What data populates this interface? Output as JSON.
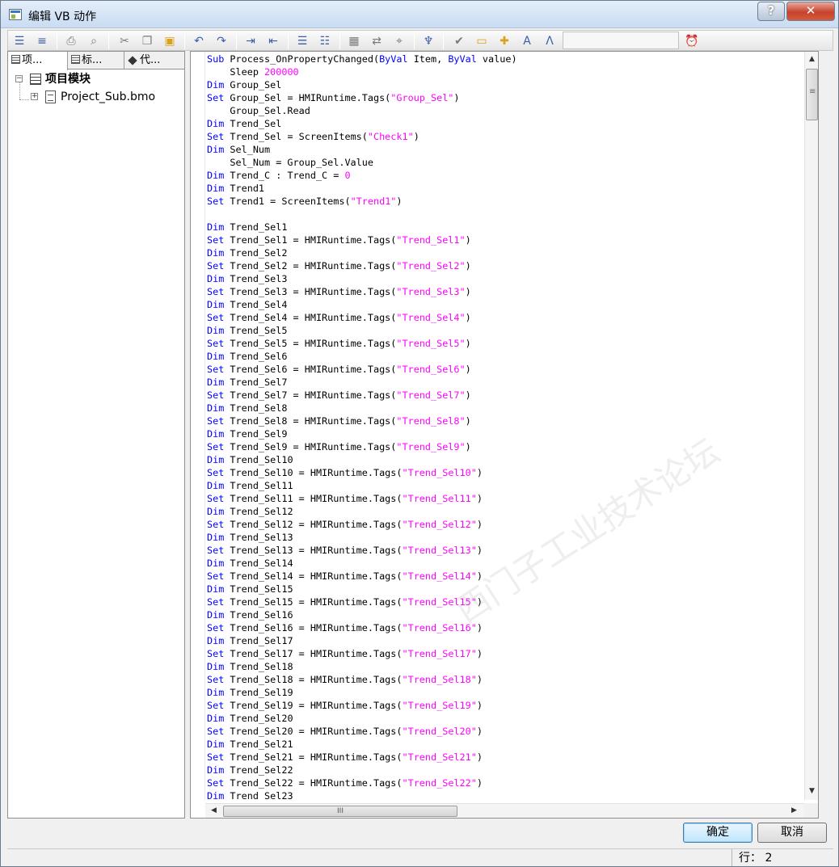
{
  "window": {
    "title": "编辑 VB 动作",
    "help_label": "?",
    "close_label": "✕"
  },
  "toolbar": {
    "icons": [
      "align-left-icon",
      "indent-icon",
      "print-icon",
      "print-preview-icon",
      "cut-icon",
      "copy-icon",
      "paste-icon",
      "undo-icon",
      "redo-icon",
      "indent-increase-icon",
      "indent-decrease-icon",
      "comment-icon",
      "uncomment-icon",
      "grid-icon",
      "replace-icon",
      "bookmark-icon",
      "properties-icon",
      "check-script-icon",
      "folder-icon",
      "insert-icon",
      "tags-icon",
      "function-icon",
      "timer-icon"
    ]
  },
  "left_panel": {
    "tabs": [
      {
        "label": "项..."
      },
      {
        "label": "标..."
      },
      {
        "label": "代..."
      }
    ],
    "tree": {
      "root_label": "项目模块",
      "child_label": "Project_Sub.bmo"
    }
  },
  "editor": {
    "lines": [
      [
        {
          "t": "Sub",
          "c": "kw"
        },
        {
          "t": " Process_OnPropertyChanged("
        },
        {
          "t": "ByVal",
          "c": "kw"
        },
        {
          "t": " Item, "
        },
        {
          "t": "ByVal",
          "c": "kw"
        },
        {
          "t": " value)"
        }
      ],
      [
        {
          "t": "    Sleep "
        },
        {
          "t": "200000",
          "c": "num"
        }
      ],
      [
        {
          "t": "Dim",
          "c": "kw"
        },
        {
          "t": " Group_Sel"
        }
      ],
      [
        {
          "t": "Set",
          "c": "kw"
        },
        {
          "t": " Group_Sel = HMIRuntime.Tags("
        },
        {
          "t": "\"Group_Sel\"",
          "c": "str"
        },
        {
          "t": ")"
        }
      ],
      [
        {
          "t": "    Group_Sel.Read"
        }
      ],
      [
        {
          "t": "Dim",
          "c": "kw"
        },
        {
          "t": " Trend_Sel"
        }
      ],
      [
        {
          "t": "Set",
          "c": "kw"
        },
        {
          "t": " Trend_Sel = ScreenItems("
        },
        {
          "t": "\"Check1\"",
          "c": "str"
        },
        {
          "t": ")"
        }
      ],
      [
        {
          "t": "Dim",
          "c": "kw"
        },
        {
          "t": " Sel_Num"
        }
      ],
      [
        {
          "t": "    Sel_Num = Group_Sel.Value"
        }
      ],
      [
        {
          "t": "Dim",
          "c": "kw"
        },
        {
          "t": " Trend_C : Trend_C = "
        },
        {
          "t": "0",
          "c": "num"
        }
      ],
      [
        {
          "t": "Dim",
          "c": "kw"
        },
        {
          "t": " Trend1"
        }
      ],
      [
        {
          "t": "Set",
          "c": "kw"
        },
        {
          "t": " Trend1 = ScreenItems("
        },
        {
          "t": "\"Trend1\"",
          "c": "str"
        },
        {
          "t": ")"
        }
      ],
      [],
      [
        {
          "t": "Dim",
          "c": "kw"
        },
        {
          "t": " Trend_Sel1"
        }
      ],
      [
        {
          "t": "Set",
          "c": "kw"
        },
        {
          "t": " Trend_Sel1 = HMIRuntime.Tags("
        },
        {
          "t": "\"Trend_Sel1\"",
          "c": "str"
        },
        {
          "t": ")"
        }
      ],
      [
        {
          "t": "Dim",
          "c": "kw"
        },
        {
          "t": " Trend_Sel2"
        }
      ],
      [
        {
          "t": "Set",
          "c": "kw"
        },
        {
          "t": " Trend_Sel2 = HMIRuntime.Tags("
        },
        {
          "t": "\"Trend_Sel2\"",
          "c": "str"
        },
        {
          "t": ")"
        }
      ],
      [
        {
          "t": "Dim",
          "c": "kw"
        },
        {
          "t": " Trend_Sel3"
        }
      ],
      [
        {
          "t": "Set",
          "c": "kw"
        },
        {
          "t": " Trend_Sel3 = HMIRuntime.Tags("
        },
        {
          "t": "\"Trend_Sel3\"",
          "c": "str"
        },
        {
          "t": ")"
        }
      ],
      [
        {
          "t": "Dim",
          "c": "kw"
        },
        {
          "t": " Trend_Sel4"
        }
      ],
      [
        {
          "t": "Set",
          "c": "kw"
        },
        {
          "t": " Trend_Sel4 = HMIRuntime.Tags("
        },
        {
          "t": "\"Trend_Sel4\"",
          "c": "str"
        },
        {
          "t": ")"
        }
      ],
      [
        {
          "t": "Dim",
          "c": "kw"
        },
        {
          "t": " Trend_Sel5"
        }
      ],
      [
        {
          "t": "Set",
          "c": "kw"
        },
        {
          "t": " Trend_Sel5 = HMIRuntime.Tags("
        },
        {
          "t": "\"Trend_Sel5\"",
          "c": "str"
        },
        {
          "t": ")"
        }
      ],
      [
        {
          "t": "Dim",
          "c": "kw"
        },
        {
          "t": " Trend_Sel6"
        }
      ],
      [
        {
          "t": "Set",
          "c": "kw"
        },
        {
          "t": " Trend_Sel6 = HMIRuntime.Tags("
        },
        {
          "t": "\"Trend_Sel6\"",
          "c": "str"
        },
        {
          "t": ")"
        }
      ],
      [
        {
          "t": "Dim",
          "c": "kw"
        },
        {
          "t": " Trend_Sel7"
        }
      ],
      [
        {
          "t": "Set",
          "c": "kw"
        },
        {
          "t": " Trend_Sel7 = HMIRuntime.Tags("
        },
        {
          "t": "\"Trend_Sel7\"",
          "c": "str"
        },
        {
          "t": ")"
        }
      ],
      [
        {
          "t": "Dim",
          "c": "kw"
        },
        {
          "t": " Trend_Sel8"
        }
      ],
      [
        {
          "t": "Set",
          "c": "kw"
        },
        {
          "t": " Trend_Sel8 = HMIRuntime.Tags("
        },
        {
          "t": "\"Trend_Sel8\"",
          "c": "str"
        },
        {
          "t": ")"
        }
      ],
      [
        {
          "t": "Dim",
          "c": "kw"
        },
        {
          "t": " Trend_Sel9"
        }
      ],
      [
        {
          "t": "Set",
          "c": "kw"
        },
        {
          "t": " Trend_Sel9 = HMIRuntime.Tags("
        },
        {
          "t": "\"Trend_Sel9\"",
          "c": "str"
        },
        {
          "t": ")"
        }
      ],
      [
        {
          "t": "Dim",
          "c": "kw"
        },
        {
          "t": " Trend_Sel10"
        }
      ],
      [
        {
          "t": "Set",
          "c": "kw"
        },
        {
          "t": " Trend_Sel10 = HMIRuntime.Tags("
        },
        {
          "t": "\"Trend_Sel10\"",
          "c": "str"
        },
        {
          "t": ")"
        }
      ],
      [
        {
          "t": "Dim",
          "c": "kw"
        },
        {
          "t": " Trend_Sel11"
        }
      ],
      [
        {
          "t": "Set",
          "c": "kw"
        },
        {
          "t": " Trend_Sel11 = HMIRuntime.Tags("
        },
        {
          "t": "\"Trend_Sel11\"",
          "c": "str"
        },
        {
          "t": ")"
        }
      ],
      [
        {
          "t": "Dim",
          "c": "kw"
        },
        {
          "t": " Trend_Sel12"
        }
      ],
      [
        {
          "t": "Set",
          "c": "kw"
        },
        {
          "t": " Trend_Sel12 = HMIRuntime.Tags("
        },
        {
          "t": "\"Trend_Sel12\"",
          "c": "str"
        },
        {
          "t": ")"
        }
      ],
      [
        {
          "t": "Dim",
          "c": "kw"
        },
        {
          "t": " Trend_Sel13"
        }
      ],
      [
        {
          "t": "Set",
          "c": "kw"
        },
        {
          "t": " Trend_Sel13 = HMIRuntime.Tags("
        },
        {
          "t": "\"Trend_Sel13\"",
          "c": "str"
        },
        {
          "t": ")"
        }
      ],
      [
        {
          "t": "Dim",
          "c": "kw"
        },
        {
          "t": " Trend_Sel14"
        }
      ],
      [
        {
          "t": "Set",
          "c": "kw"
        },
        {
          "t": " Trend_Sel14 = HMIRuntime.Tags("
        },
        {
          "t": "\"Trend_Sel14\"",
          "c": "str"
        },
        {
          "t": ")"
        }
      ],
      [
        {
          "t": "Dim",
          "c": "kw"
        },
        {
          "t": " Trend_Sel15"
        }
      ],
      [
        {
          "t": "Set",
          "c": "kw"
        },
        {
          "t": " Trend_Sel15 = HMIRuntime.Tags("
        },
        {
          "t": "\"Trend_Sel15\"",
          "c": "str"
        },
        {
          "t": ")"
        }
      ],
      [
        {
          "t": "Dim",
          "c": "kw"
        },
        {
          "t": " Trend_Sel16"
        }
      ],
      [
        {
          "t": "Set",
          "c": "kw"
        },
        {
          "t": " Trend_Sel16 = HMIRuntime.Tags("
        },
        {
          "t": "\"Trend_Sel16\"",
          "c": "str"
        },
        {
          "t": ")"
        }
      ],
      [
        {
          "t": "Dim",
          "c": "kw"
        },
        {
          "t": " Trend_Sel17"
        }
      ],
      [
        {
          "t": "Set",
          "c": "kw"
        },
        {
          "t": " Trend_Sel17 = HMIRuntime.Tags("
        },
        {
          "t": "\"Trend_Sel17\"",
          "c": "str"
        },
        {
          "t": ")"
        }
      ],
      [
        {
          "t": "Dim",
          "c": "kw"
        },
        {
          "t": " Trend_Sel18"
        }
      ],
      [
        {
          "t": "Set",
          "c": "kw"
        },
        {
          "t": " Trend_Sel18 = HMIRuntime.Tags("
        },
        {
          "t": "\"Trend_Sel18\"",
          "c": "str"
        },
        {
          "t": ")"
        }
      ],
      [
        {
          "t": "Dim",
          "c": "kw"
        },
        {
          "t": " Trend_Sel19"
        }
      ],
      [
        {
          "t": "Set",
          "c": "kw"
        },
        {
          "t": " Trend_Sel19 = HMIRuntime.Tags("
        },
        {
          "t": "\"Trend_Sel19\"",
          "c": "str"
        },
        {
          "t": ")"
        }
      ],
      [
        {
          "t": "Dim",
          "c": "kw"
        },
        {
          "t": " Trend_Sel20"
        }
      ],
      [
        {
          "t": "Set",
          "c": "kw"
        },
        {
          "t": " Trend_Sel20 = HMIRuntime.Tags("
        },
        {
          "t": "\"Trend_Sel20\"",
          "c": "str"
        },
        {
          "t": ")"
        }
      ],
      [
        {
          "t": "Dim",
          "c": "kw"
        },
        {
          "t": " Trend_Sel21"
        }
      ],
      [
        {
          "t": "Set",
          "c": "kw"
        },
        {
          "t": " Trend_Sel21 = HMIRuntime.Tags("
        },
        {
          "t": "\"Trend_Sel21\"",
          "c": "str"
        },
        {
          "t": ")"
        }
      ],
      [
        {
          "t": "Dim",
          "c": "kw"
        },
        {
          "t": " Trend_Sel22"
        }
      ],
      [
        {
          "t": "Set",
          "c": "kw"
        },
        {
          "t": " Trend_Sel22 = HMIRuntime.Tags("
        },
        {
          "t": "\"Trend_Sel22\"",
          "c": "str"
        },
        {
          "t": ")"
        }
      ],
      [
        {
          "t": "Dim",
          "c": "kw"
        },
        {
          "t": " Trend_Sel23"
        }
      ]
    ],
    "hscroll_grip": "III"
  },
  "buttons": {
    "ok_label": "确定",
    "cancel_label": "取消"
  },
  "statusbar": {
    "line_text": "行： 2"
  },
  "colors": {
    "keyword": "#0000ff",
    "string": "#ff00ff"
  }
}
